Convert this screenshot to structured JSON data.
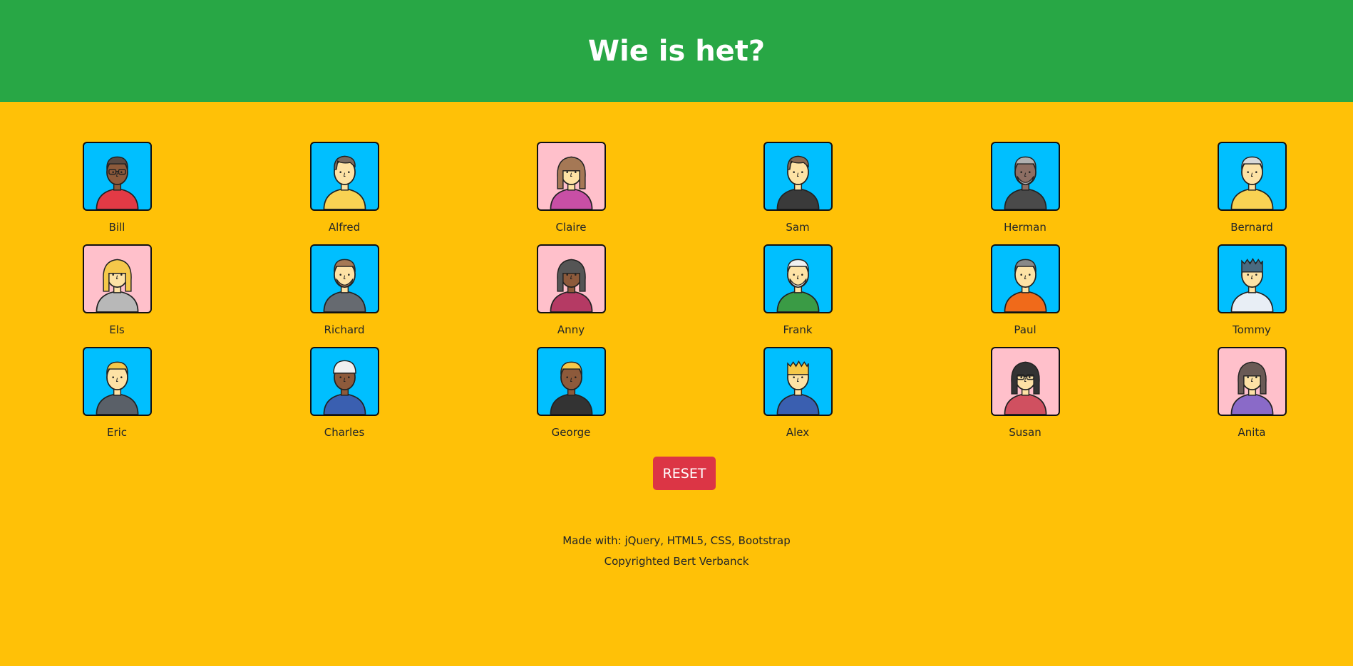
{
  "header": {
    "title": "Wie is het?"
  },
  "characters": [
    {
      "name": "Bill",
      "bg": "#00bfff",
      "skin": "#8d5a3b",
      "hair": "#5a4a42",
      "shirt": "#e23a45",
      "hairStyle": "short",
      "glasses": true,
      "beard": false
    },
    {
      "name": "Alfred",
      "bg": "#00bfff",
      "skin": "#fde2a5",
      "hair": "#7a6a60",
      "shirt": "#f8d253",
      "hairStyle": "side",
      "glasses": false,
      "beard": false
    },
    {
      "name": "Claire",
      "bg": "#ffc0cb",
      "skin": "#fde2a5",
      "hair": "#a57855",
      "shirt": "#c84fa5",
      "hairStyle": "long",
      "glasses": false,
      "beard": false
    },
    {
      "name": "Sam",
      "bg": "#00bfff",
      "skin": "#fde2a5",
      "hair": "#8b6a52",
      "shirt": "#3a3a3a",
      "hairStyle": "side",
      "glasses": false,
      "beard": false
    },
    {
      "name": "Herman",
      "bg": "#00bfff",
      "skin": "#8d6e63",
      "hair": "#b0b0b0",
      "shirt": "#4a4a4a",
      "hairStyle": "short",
      "glasses": false,
      "beard": true
    },
    {
      "name": "Bernard",
      "bg": "#00bfff",
      "skin": "#fde2a5",
      "hair": "#d8d8d8",
      "shirt": "#f8d253",
      "hairStyle": "short",
      "glasses": false,
      "beard": false
    },
    {
      "name": "Els",
      "bg": "#ffc0cb",
      "skin": "#fde2a5",
      "hair": "#f5c84a",
      "shirt": "#b8b8b8",
      "hairStyle": "long",
      "glasses": false,
      "beard": false
    },
    {
      "name": "Richard",
      "bg": "#00bfff",
      "skin": "#fde2a5",
      "hair": "#a57855",
      "shirt": "#666a70",
      "hairStyle": "short",
      "glasses": false,
      "beard": true
    },
    {
      "name": "Anny",
      "bg": "#ffc0cb",
      "skin": "#8d5a3b",
      "hair": "#555555",
      "shirt": "#b53a64",
      "hairStyle": "long",
      "glasses": false,
      "beard": false
    },
    {
      "name": "Frank",
      "bg": "#00bfff",
      "skin": "#fde2a5",
      "hair": "#f0f0f0",
      "shirt": "#3a9b45",
      "hairStyle": "short",
      "glasses": false,
      "beard": true
    },
    {
      "name": "Paul",
      "bg": "#00bfff",
      "skin": "#fde2a5",
      "hair": "#888888",
      "shirt": "#f06a1a",
      "hairStyle": "short",
      "glasses": false,
      "beard": false
    },
    {
      "name": "Tommy",
      "bg": "#00bfff",
      "skin": "#fde2a5",
      "hair": "#4a6a80",
      "shirt": "#e8eef5",
      "hairStyle": "spiky",
      "glasses": false,
      "beard": false
    },
    {
      "name": "Eric",
      "bg": "#00bfff",
      "skin": "#fde2a5",
      "hair": "#f5c84a",
      "shirt": "#5a6068",
      "hairStyle": "short",
      "glasses": false,
      "beard": false
    },
    {
      "name": "Charles",
      "bg": "#00bfff",
      "skin": "#8d5a3b",
      "hair": "#f0f0f0",
      "shirt": "#3a5fb0",
      "hairStyle": "cap",
      "glasses": false,
      "beard": false
    },
    {
      "name": "George",
      "bg": "#00bfff",
      "skin": "#8d5a3b",
      "hair": "#f5c84a",
      "shirt": "#333333",
      "hairStyle": "short",
      "glasses": false,
      "beard": false
    },
    {
      "name": "Alex",
      "bg": "#00bfff",
      "skin": "#fde2a5",
      "hair": "#f5c84a",
      "shirt": "#3a5fb0",
      "hairStyle": "spiky",
      "glasses": false,
      "beard": false
    },
    {
      "name": "Susan",
      "bg": "#ffc0cb",
      "skin": "#fde2a5",
      "hair": "#333333",
      "shirt": "#d05060",
      "hairStyle": "long",
      "glasses": true,
      "beard": false
    },
    {
      "name": "Anita",
      "bg": "#ffc0cb",
      "skin": "#fde2a5",
      "hair": "#6a5a55",
      "shirt": "#8a6ac8",
      "hairStyle": "long",
      "glasses": false,
      "beard": false
    }
  ],
  "reset": {
    "label": "RESET"
  },
  "footer": {
    "line1": "Made with: jQuery, HTML5, CSS, Bootstrap",
    "line2": "Copyrighted Bert Verbanck"
  }
}
